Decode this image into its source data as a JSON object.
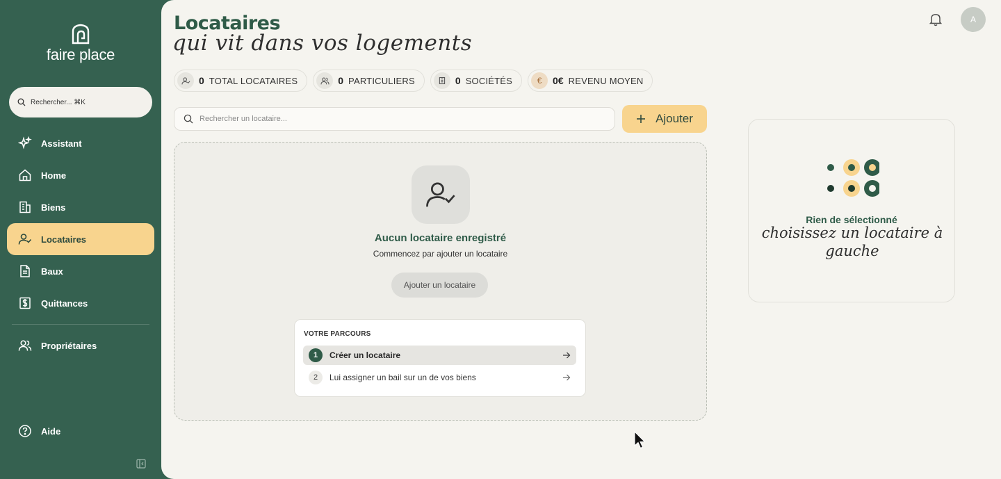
{
  "brand": {
    "name": "faire place"
  },
  "sidebar": {
    "search_text": "Rechercher... ⌘K",
    "items": [
      {
        "label": "Assistant",
        "icon": "sparkle-icon",
        "active": false
      },
      {
        "label": "Home",
        "icon": "home-icon",
        "active": false
      },
      {
        "label": "Biens",
        "icon": "building-icon",
        "active": false
      },
      {
        "label": "Locataires",
        "icon": "user-check-icon",
        "active": true
      },
      {
        "label": "Baux",
        "icon": "document-icon",
        "active": false
      },
      {
        "label": "Quittances",
        "icon": "receipt-icon",
        "active": false
      }
    ],
    "secondary": [
      {
        "label": "Propriétaires",
        "icon": "users-icon"
      }
    ],
    "help": "Aide"
  },
  "header": {
    "title": "Locataires",
    "subtitle": "qui vit dans vos logements",
    "avatar_initial": "A"
  },
  "stats": [
    {
      "value": "0",
      "label": "Total locataires",
      "icon": "user-check-icon"
    },
    {
      "value": "0",
      "label": "Particuliers",
      "icon": "users-icon"
    },
    {
      "value": "0",
      "label": "Sociétés",
      "icon": "building-icon"
    },
    {
      "value": "0€",
      "label": "Revenu moyen",
      "icon": "euro-icon",
      "symbol": "€"
    }
  ],
  "search": {
    "placeholder": "Rechercher un locataire...",
    "value": ""
  },
  "add_button": {
    "label": "Ajouter"
  },
  "empty_state": {
    "title": "Aucun locataire enregistré",
    "subtitle": "Commencez par ajouter un locataire",
    "button": "Ajouter un locataire"
  },
  "journey": {
    "title": "VOTRE PARCOURS",
    "steps": [
      {
        "num": "1",
        "label": "Créer un locataire",
        "active": true
      },
      {
        "num": "2",
        "label": "Lui assigner un bail sur un de vos biens",
        "active": false
      }
    ]
  },
  "detail": {
    "title": "Rien de sélectionné",
    "subtitle": "choisissez un locataire à gauche"
  },
  "colors": {
    "sidebar": "#356150",
    "accent": "#f8d48e",
    "primary_text": "#2f5b48",
    "background": "#f5f4ef"
  }
}
